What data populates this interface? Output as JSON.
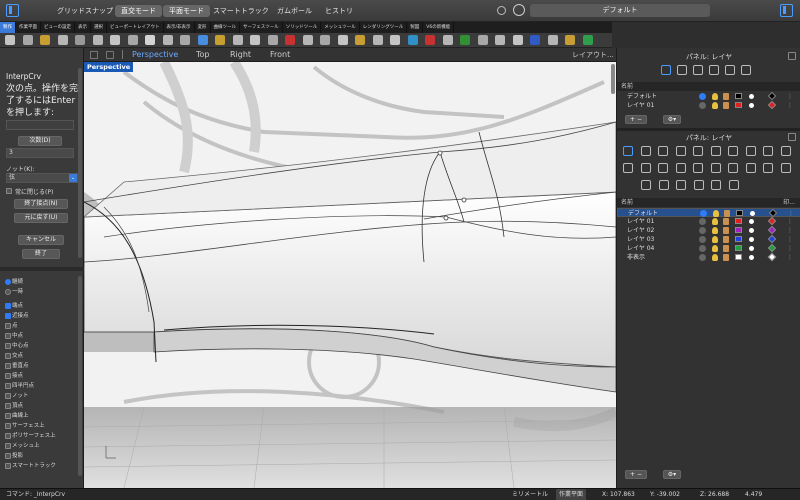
{
  "titlebar": {
    "items": [
      "グリッドスナップ",
      "直交モード",
      "平面モード",
      "スマートトラック",
      "ガムボール",
      "ヒストリ"
    ],
    "default_view": "デフォルト"
  },
  "tabs": [
    "製作",
    "作業平面",
    "ビューの設定",
    "表示",
    "選択",
    "ビューポートレイアウト",
    "表示/非表示",
    "変形",
    "曲線ツール",
    "サーフェスツール",
    "ソリッドツール",
    "メッシュツール",
    "レンダリングツール",
    "製図",
    "V6の新機能"
  ],
  "viewport_tabs": {
    "perspective": "Perspective",
    "top": "Top",
    "right": "Right",
    "front": "Front",
    "layout": "レイアウト..."
  },
  "viewport": {
    "name": "Perspective"
  },
  "command": {
    "title": "InterpCrv",
    "prompt": "次の点。操作を完了するにはEnterを押します:",
    "degree_label": "次数(D)",
    "degree_value": "3",
    "knot_label": "ノット(K):",
    "knot_value": "弦",
    "closed_label": "常に閉じる(P)",
    "end_tangent_btn": "終了接点(N)",
    "undo_btn": "元に戻す(U)",
    "cancel_btn": "キャンセル",
    "done_btn": "終了"
  },
  "osnap": {
    "modes": [
      {
        "label": "継続",
        "on": true
      },
      {
        "label": "一時",
        "on": false
      }
    ],
    "items": [
      {
        "label": "端点",
        "on": true
      },
      {
        "label": "近接点",
        "on": true
      },
      {
        "label": "点",
        "on": false
      },
      {
        "label": "中点",
        "on": false
      },
      {
        "label": "中心点",
        "on": false
      },
      {
        "label": "交点",
        "on": false
      },
      {
        "label": "垂直点",
        "on": false
      },
      {
        "label": "接点",
        "on": false
      },
      {
        "label": "四半円点",
        "on": false
      },
      {
        "label": "ノット",
        "on": false
      },
      {
        "label": "頂点",
        "on": false
      },
      {
        "label": "曲線上",
        "on": false
      },
      {
        "label": "サーフェス上",
        "on": false
      },
      {
        "label": "ポリサーフェス上",
        "on": false
      },
      {
        "label": "メッシュ上",
        "on": false
      },
      {
        "label": "投影",
        "on": false
      },
      {
        "label": "スマートトラック",
        "on": false
      }
    ]
  },
  "layers_top": {
    "title": "パネル: レイヤ",
    "header": "名前",
    "rows": [
      {
        "name": "デフォルト",
        "color": "#000000"
      },
      {
        "name": "レイヤ 01",
        "color": "#e02020"
      }
    ]
  },
  "layers_bottom": {
    "title": "パネル: レイヤ",
    "header": "名前",
    "header_right": "印...",
    "rows": [
      {
        "name": "デフォルト",
        "color": "#000000"
      },
      {
        "name": "レイヤ 01",
        "color": "#e02020"
      },
      {
        "name": "レイヤ 02",
        "color": "#a020c0"
      },
      {
        "name": "レイヤ 03",
        "color": "#2040e0"
      },
      {
        "name": "レイヤ 04",
        "color": "#20a040"
      },
      {
        "name": "非表示",
        "color": "#ffffff"
      }
    ]
  },
  "status": {
    "command": "コマンド: _InterpCrv",
    "units": "ミリメートル",
    "cplane": "作業平面",
    "x": "X: 107.863",
    "y": "Y: -39.002",
    "z": "Z: 26.688",
    "dist": "4.479"
  },
  "colors": {
    "accent": "#3a7ad9",
    "badge": "#1a5ab5"
  }
}
